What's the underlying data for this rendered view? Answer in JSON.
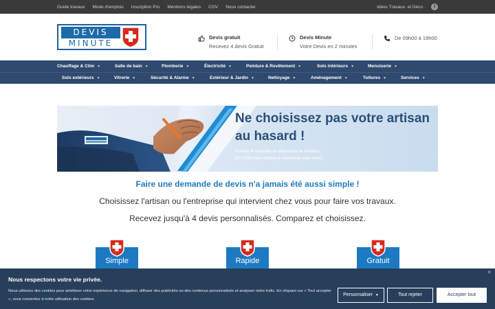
{
  "topbar": {
    "links": [
      "Guide travaux",
      "Mode d'emplois",
      "Inscription Pro",
      "Mentions légales",
      "CGV",
      "Nous contacter"
    ],
    "right_link": "Idées Travaux. et Déco",
    "facebook_icon": "facebook-icon"
  },
  "header": {
    "logo_top": "DEVIS",
    "logo_bottom": "MINUTE",
    "info1": {
      "icon": "thumbs-up-icon",
      "title": "Devis gratuit",
      "subtitle": "Recevez 4 devis Gratuit"
    },
    "info2": {
      "icon": "clock-icon",
      "title": "Devis Minute",
      "subtitle": "Votre Devis en 2 minutes"
    },
    "info3": {
      "icon": "phone-icon",
      "title": "De 09h00 à 19h00"
    }
  },
  "nav": {
    "row1": [
      "Chauffage & Clim",
      "Salle de bain",
      "Plomberie",
      "Électricité",
      "Peinture & Revêtement",
      "Sols intérieurs",
      "Menuiserie"
    ],
    "row2": [
      "Sols extérieurs",
      "Vitrerie",
      "Sécurité & Alarme",
      "Extérieur & Jardin",
      "Nettoyage",
      "Aménagement",
      "Toitures",
      "Services"
    ]
  },
  "banner": {
    "headline": "Ne choisissez pas votre artisan au hasard !",
    "sub1": "Prenez le contrôle et choisissez le meilleur.",
    "sub2": "En 2 Minutes chrono je demande mes devis."
  },
  "main": {
    "tagline": "Faire une demande de devis n'a jamais été aussi simple !",
    "p1": "Choisissez l'artisan ou l'entreprise qui intervient chez vous pour faire vos travaux.",
    "p2": "Recevez jusqu'à 4 devis personnalisés. Comparez et choisissez.",
    "badges": [
      "Simple",
      "Rapide",
      "Gratuit"
    ]
  },
  "cookie": {
    "title": "Nous respectons votre vie privée.",
    "desc": "Nous utilisons des cookies pour améliorer votre expérience de navigation, diffuser des publicités ou des contenus personnalisés et analyser notre trafic. En cliquant sur « Tout accepter », vous consentez à notre utilisation des cookies.",
    "btn_customize": "Personnaliser",
    "btn_reject": "Tout rejeter",
    "btn_accept": "Accepter tout",
    "close": "×"
  },
  "colors": {
    "nav": "#2f4a6e",
    "brand_blue": "#1d7ac2",
    "swiss_red": "#d52b1e",
    "cookie_bg": "#283f5c"
  }
}
